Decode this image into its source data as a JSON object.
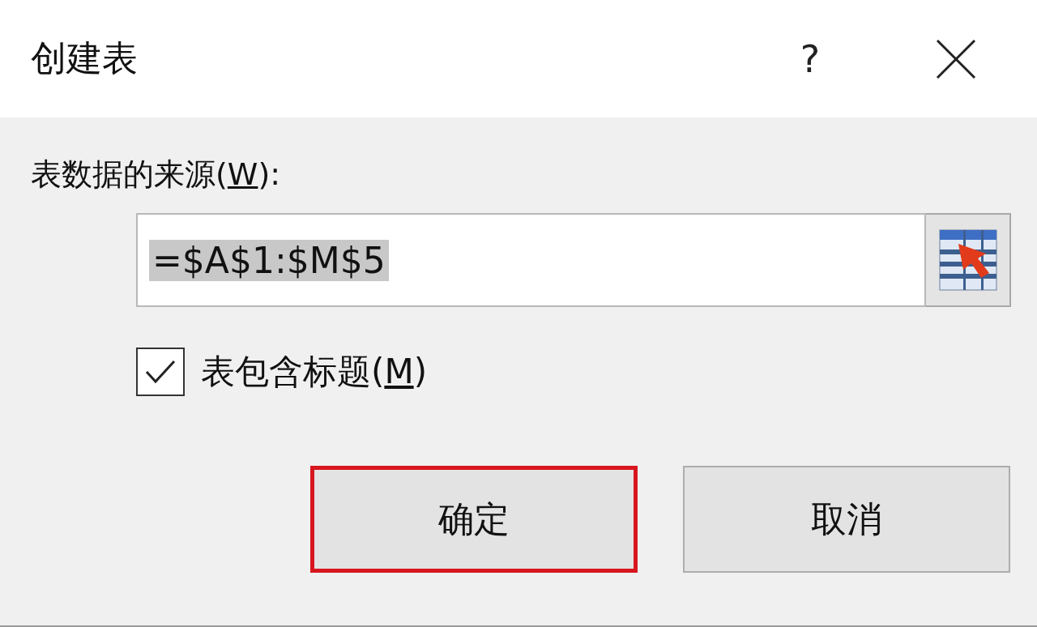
{
  "window": {
    "title": "创建表",
    "help": "?"
  },
  "source": {
    "label_before": "表数据的来源(",
    "access_key": "W",
    "label_after": "):",
    "value": "=$A$1:$M$5",
    "selected": true
  },
  "header_checkbox": {
    "label_before": "表包含标题(",
    "access_key": "M",
    "label_after": ")",
    "checked": true
  },
  "buttons": [
    {
      "label": "确定",
      "highlighted": true
    },
    {
      "label": "取消",
      "highlighted": false
    }
  ]
}
